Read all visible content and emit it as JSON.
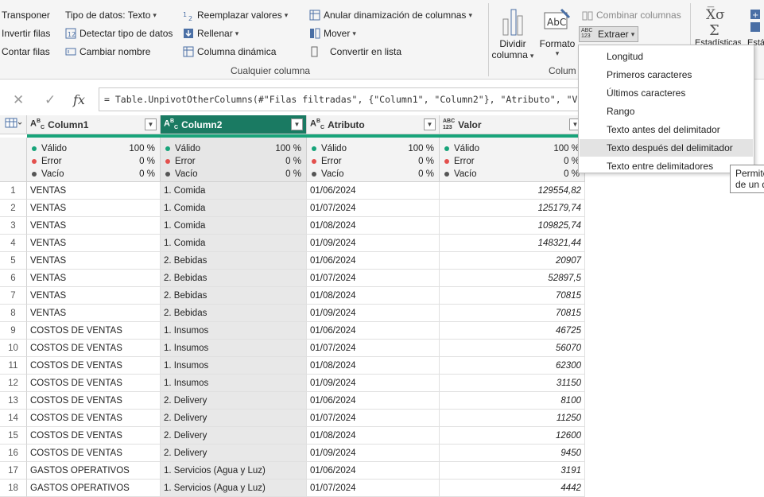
{
  "ribbon": {
    "col1": [
      "Transponer",
      "Invertir filas",
      "Contar filas"
    ],
    "data_type": "Tipo de datos: Texto",
    "detect_type": "Detectar tipo de datos",
    "rename": "Cambiar nombre",
    "replace_values": "Reemplazar valores",
    "fill": "Rellenar",
    "pivot_column": "Columna dinámica",
    "unpivot": "Anular dinamización de columnas",
    "move": "Mover",
    "convert_list": "Convertir en lista",
    "group_any_column": "Cualquier columna",
    "split_column_1": "Dividir",
    "split_column_2": "columna",
    "format": "Formato",
    "merge_columns": "Combinar columnas",
    "extract": "Extraer",
    "group_text_partial": "Colum",
    "stats_partial": "Estadísticas",
    "stats_partial2": "Está"
  },
  "formula": {
    "text": "= Table.UnpivotOtherColumns(#\"Filas filtradas\", {\"Column1\", \"Column2\"}, \"Atributo\", \"Va"
  },
  "columns": [
    {
      "name": "Column1",
      "type": "ABC"
    },
    {
      "name": "Column2",
      "type": "ABC"
    },
    {
      "name": "Atributo",
      "type": "ABC"
    },
    {
      "name": "Valor",
      "type": "ABC 123"
    }
  ],
  "quality": {
    "valid_label": "Válido",
    "error_label": "Error",
    "empty_label": "Vacío",
    "valid_pct": "100 %",
    "error_pct": "0 %",
    "empty_pct": "0 %",
    "colors": {
      "valid": "#18a47a",
      "error": "#e3504d",
      "empty": "#555555"
    }
  },
  "rows": [
    [
      "1",
      "VENTAS",
      "1. Comida",
      "01/06/2024",
      "129554,82"
    ],
    [
      "2",
      "VENTAS",
      "1. Comida",
      "01/07/2024",
      "125179,74"
    ],
    [
      "3",
      "VENTAS",
      "1. Comida",
      "01/08/2024",
      "109825,74"
    ],
    [
      "4",
      "VENTAS",
      "1. Comida",
      "01/09/2024",
      "148321,44"
    ],
    [
      "5",
      "VENTAS",
      "2. Bebidas",
      "01/06/2024",
      "20907"
    ],
    [
      "6",
      "VENTAS",
      "2. Bebidas",
      "01/07/2024",
      "52897,5"
    ],
    [
      "7",
      "VENTAS",
      "2. Bebidas",
      "01/08/2024",
      "70815"
    ],
    [
      "8",
      "VENTAS",
      "2. Bebidas",
      "01/09/2024",
      "70815"
    ],
    [
      "9",
      "COSTOS DE VENTAS",
      "1. Insumos",
      "01/06/2024",
      "46725"
    ],
    [
      "10",
      "COSTOS DE VENTAS",
      "1. Insumos",
      "01/07/2024",
      "56070"
    ],
    [
      "11",
      "COSTOS DE VENTAS",
      "1. Insumos",
      "01/08/2024",
      "62300"
    ],
    [
      "12",
      "COSTOS DE VENTAS",
      "1. Insumos",
      "01/09/2024",
      "31150"
    ],
    [
      "13",
      "COSTOS DE VENTAS",
      "2. Delivery",
      "01/06/2024",
      "8100"
    ],
    [
      "14",
      "COSTOS DE VENTAS",
      "2. Delivery",
      "01/07/2024",
      "11250"
    ],
    [
      "15",
      "COSTOS DE VENTAS",
      "2. Delivery",
      "01/08/2024",
      "12600"
    ],
    [
      "16",
      "COSTOS DE VENTAS",
      "2. Delivery",
      "01/09/2024",
      "9450"
    ],
    [
      "17",
      "GASTOS OPERATIVOS",
      "1. Servicios (Agua y Luz)",
      "01/06/2024",
      "3191"
    ],
    [
      "18",
      "GASTOS OPERATIVOS",
      "1. Servicios (Agua y Luz)",
      "01/07/2024",
      "4442"
    ]
  ],
  "extract_menu": {
    "items": [
      "Longitud",
      "Primeros caracteres",
      "Últimos caracteres",
      "Rango",
      "Texto antes del delimitador",
      "Texto después del delimitador",
      "Texto entre delimitadores"
    ],
    "highlighted": 5
  },
  "tooltip": {
    "line1": "Permite",
    "line2": "de un d"
  }
}
